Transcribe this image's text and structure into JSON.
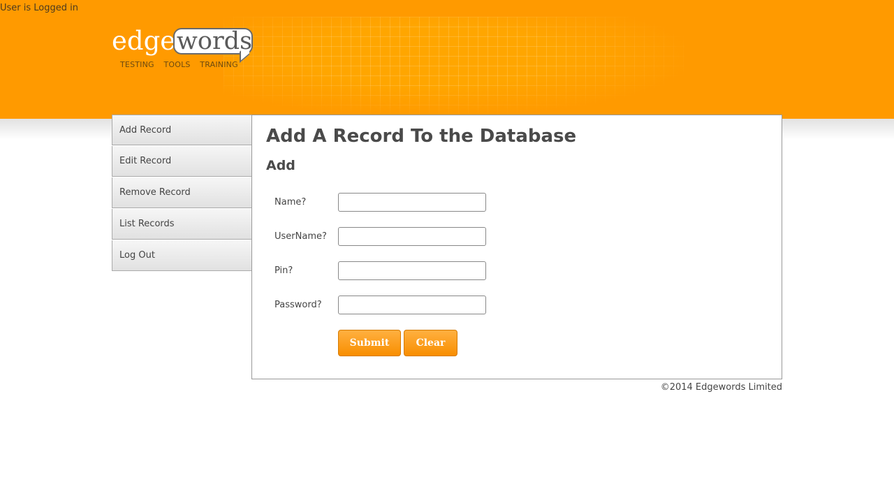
{
  "header": {
    "login_status": "User is Logged in",
    "logo": {
      "edge": "edge",
      "words": "words",
      "tagline": "TESTING TOOLS TRAINING"
    },
    "brand_color": "#ff9a00"
  },
  "sidebar": {
    "items": [
      {
        "label": "Add Record"
      },
      {
        "label": "Edit Record"
      },
      {
        "label": "Remove Record"
      },
      {
        "label": "List Records"
      },
      {
        "label": "Log Out"
      }
    ]
  },
  "main": {
    "title": "Add A Record To the Database",
    "section": "Add",
    "fields": [
      {
        "label": "Name?",
        "value": ""
      },
      {
        "label": "UserName?",
        "value": ""
      },
      {
        "label": "Pin?",
        "value": ""
      },
      {
        "label": "Password?",
        "value": ""
      }
    ],
    "buttons": {
      "submit": "Submit",
      "clear": "Clear"
    }
  },
  "footer": {
    "copyright": "©2014 Edgewords Limited"
  }
}
